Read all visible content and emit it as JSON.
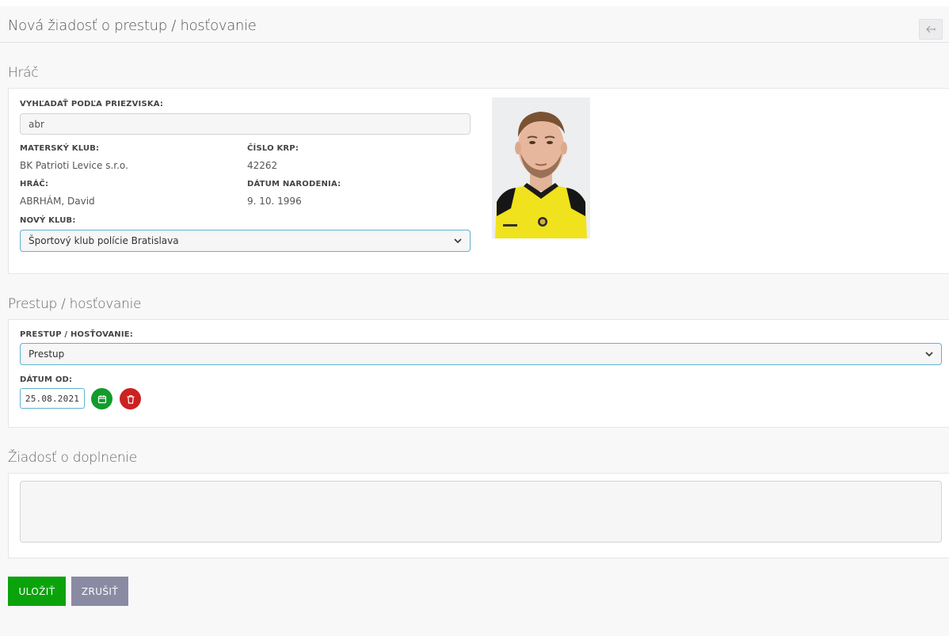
{
  "header": {
    "title": "Nová žiadosť o prestup / hosťovanie",
    "back_icon": "back-arrow-icon"
  },
  "player_section": {
    "title": "Hráč",
    "search_label": "VYHĽADAŤ PODĽA PRIEZVISKA:",
    "search_value": "abr",
    "home_club_label": "MATERSKÝ KLUB:",
    "home_club_value": "BK Patrioti Levice s.r.o.",
    "krp_label": "ČÍSLO KRP:",
    "krp_value": "42262",
    "player_label": "HRÁČ:",
    "player_value": "ABRHÁM, David",
    "birth_label": "DÁTUM NARODENIA:",
    "birth_value": "9. 10. 1996",
    "new_club_label": "NOVÝ KLUB:",
    "new_club_value": "Športový klub polície Bratislava"
  },
  "transfer_section": {
    "title": "Prestup / hosťovanie",
    "type_label": "PRESTUP / HOSŤOVANIE:",
    "type_value": "Prestup",
    "date_label": "DÁTUM OD:",
    "date_value": "25.08.2021",
    "calendar_icon": "calendar-icon",
    "delete_icon": "trash-icon"
  },
  "request_section": {
    "title": "Žiadosť o doplnenie",
    "text_value": ""
  },
  "actions": {
    "save_label": "ULOŽIŤ",
    "cancel_label": "ZRUŠIŤ"
  },
  "colors": {
    "save": "#0ba30b",
    "cancel": "#8a8aa3",
    "calendar_button": "#139b2b",
    "delete_button": "#cc2121",
    "focus_border": "#5fb3d4"
  }
}
